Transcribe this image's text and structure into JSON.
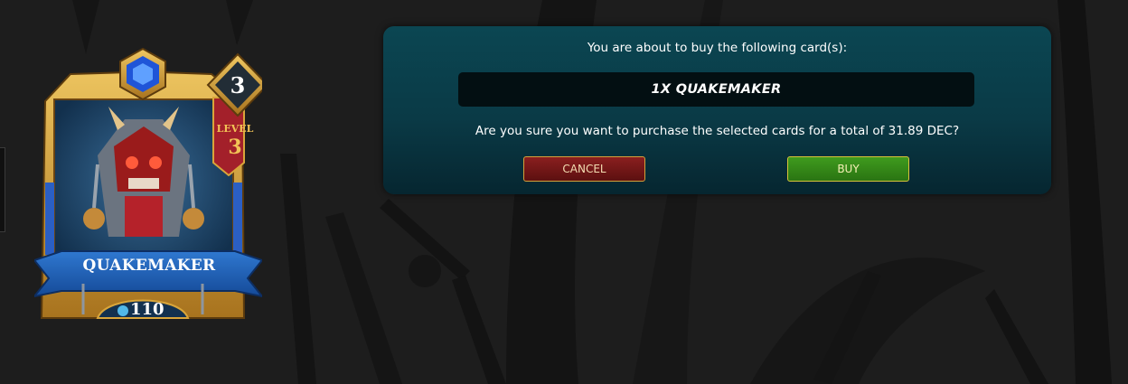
{
  "card": {
    "name": "QUAKEMAKER",
    "level_word": "LEVEL",
    "level": "3",
    "rarity_mana": "3",
    "power_value": "110",
    "colors": {
      "frame_gold": "#d9a53a",
      "banner_blue": "#1f5fb8",
      "level_red": "#a3202a"
    }
  },
  "dialog": {
    "title": "You are about to buy the following card(s):",
    "card_line": "1X QUAKEMAKER",
    "question": "Are you sure you want to purchase the selected cards for a total of 31.89 DEC?",
    "cancel_label": "CANCEL",
    "buy_label": "BUY"
  }
}
